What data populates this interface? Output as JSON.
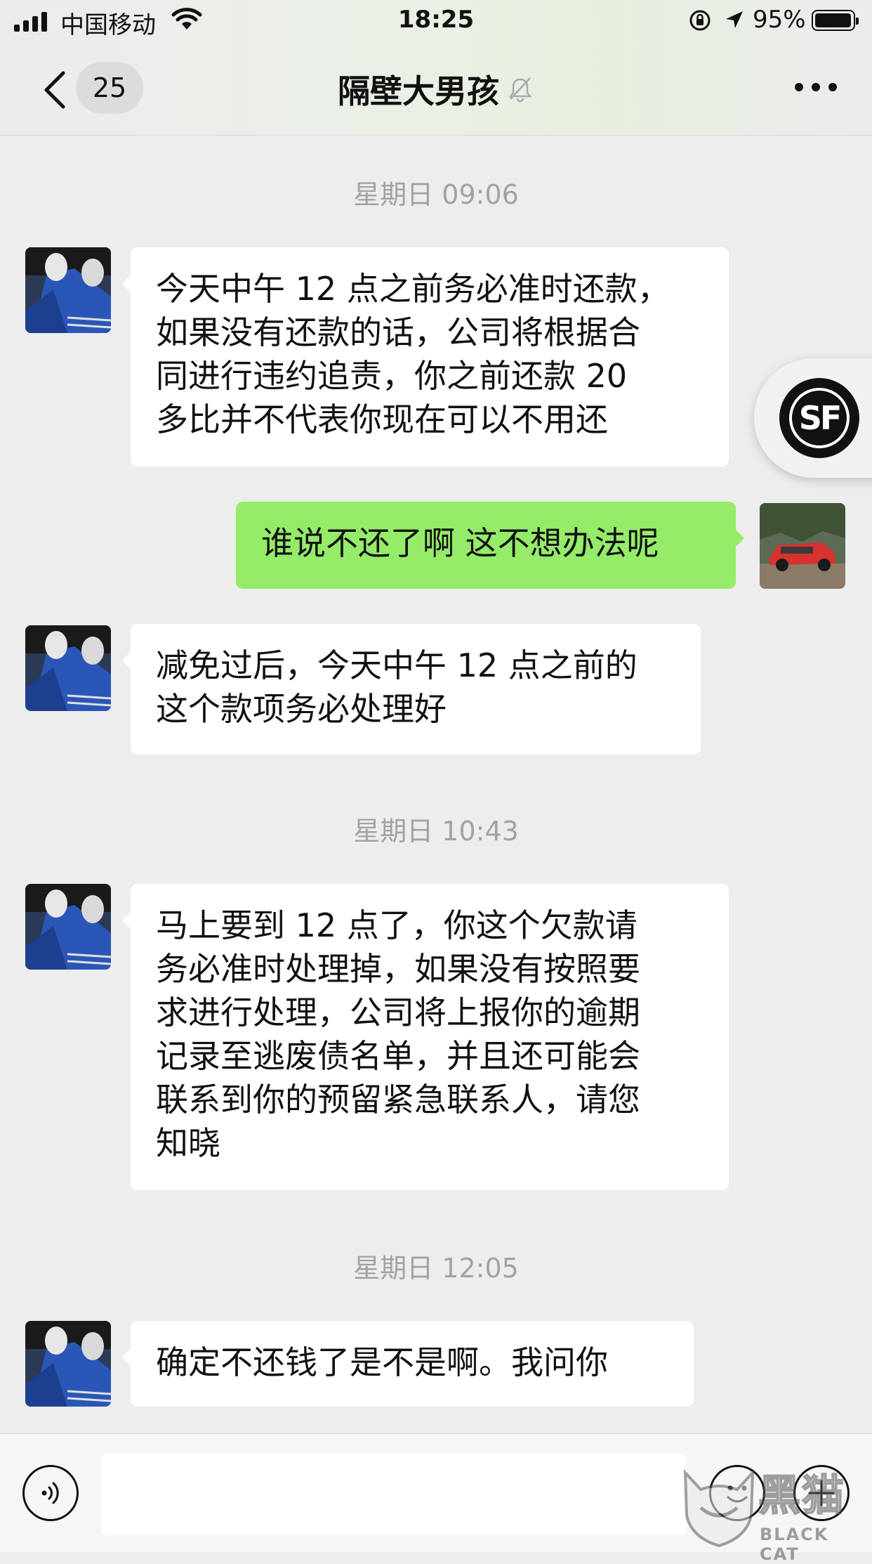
{
  "status_bar": {
    "carrier": "中国移动",
    "time": "18:25",
    "battery": "95%",
    "battery_level": 0.95,
    "signal_bars": 4
  },
  "nav": {
    "unread_count": "25",
    "title": "隔壁大男孩",
    "muted": true
  },
  "messages": [
    {
      "type": "timestamp",
      "text": "星期日 09:06"
    },
    {
      "type": "incoming",
      "text": "今天中午 12 点之前务必准时还款，\n如果没有还款的话，公司将根据合\n同进行违约追责，你之前还款 20\n多比并不代表你现在可以不用还"
    },
    {
      "type": "outgoing",
      "text": "谁说不还了啊 这不想办法呢"
    },
    {
      "type": "incoming",
      "text": "减免过后，今天中午 12 点之前的\n这个款项务必处理好"
    },
    {
      "type": "timestamp",
      "text": "星期日 10:43"
    },
    {
      "type": "incoming",
      "text": "马上要到 12 点了，你这个欠款请\n务必准时处理掉，如果没有按照要\n求进行处理，公司将上报你的逾期\n记录至逃废债名单，并且还可能会\n联系到你的预留紧急联系人，请您\n知晓"
    },
    {
      "type": "timestamp",
      "text": "星期日 12:05"
    },
    {
      "type": "incoming",
      "text": "确定不还钱了是不是啊。我问你"
    }
  ],
  "floating": {
    "logo_text": "SF"
  },
  "input": {
    "value": "",
    "placeholder": ""
  },
  "watermark": {
    "cn": "黑猫",
    "en": "BLACK CAT"
  },
  "colors": {
    "outgoing_bubble": "#95ec69",
    "incoming_bubble": "#ffffff",
    "background": "#ededed",
    "timestamp": "#a2a2a2"
  }
}
